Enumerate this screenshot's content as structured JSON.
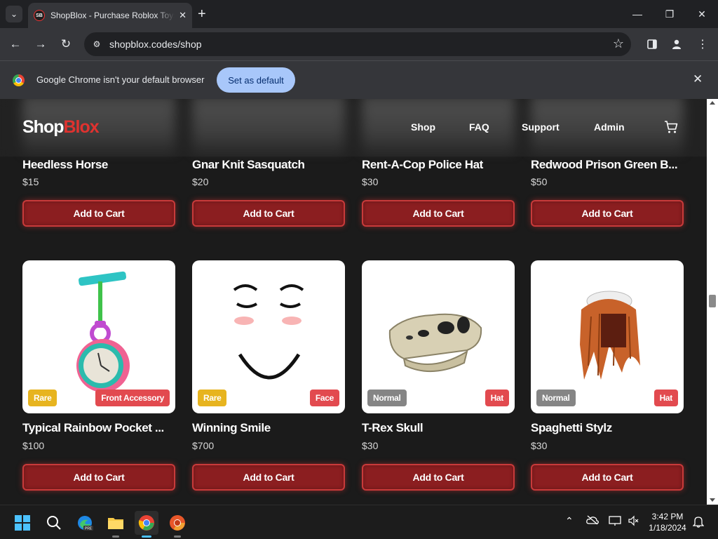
{
  "browser": {
    "tab_title": "ShopBlox - Purchase Roblox Toys",
    "favicon_text": "SB",
    "url": "shopblox.codes/shop",
    "infobar_text": "Google Chrome isn't your default browser",
    "set_default_label": "Set as default"
  },
  "site": {
    "logo_part1": "Shop",
    "logo_part2": "Blox",
    "nav": [
      "Shop",
      "FAQ",
      "Support",
      "Admin"
    ]
  },
  "products_row1": [
    {
      "name": "Heedless Horse",
      "price": "$15",
      "button": "Add to Cart"
    },
    {
      "name": "Gnar Knit Sasquatch",
      "price": "$20",
      "button": "Add to Cart"
    },
    {
      "name": "Rent-A-Cop Police Hat",
      "price": "$30",
      "button": "Add to Cart"
    },
    {
      "name": "Redwood Prison Green B...",
      "price": "$50",
      "button": "Add to Cart"
    }
  ],
  "products_row2": [
    {
      "name": "Typical Rainbow Pocket ...",
      "price": "$100",
      "rarity": "Rare",
      "type": "Front Accessory",
      "button": "Add to Cart"
    },
    {
      "name": "Winning Smile",
      "price": "$700",
      "rarity": "Rare",
      "type": "Face",
      "button": "Add to Cart"
    },
    {
      "name": "T-Rex Skull",
      "price": "$30",
      "rarity": "Normal",
      "type": "Hat",
      "button": "Add to Cart"
    },
    {
      "name": "Spaghetti Stylz",
      "price": "$30",
      "rarity": "Normal",
      "type": "Hat",
      "button": "Add to Cart"
    }
  ],
  "taskbar": {
    "time": "3:42 PM",
    "date": "1/18/2024"
  },
  "colors": {
    "accent_red": "#e0322f",
    "button_red": "#8b1e20",
    "rare_badge": "#e7b41f",
    "normal_badge": "#858585",
    "type_badge": "#e24a4f"
  }
}
